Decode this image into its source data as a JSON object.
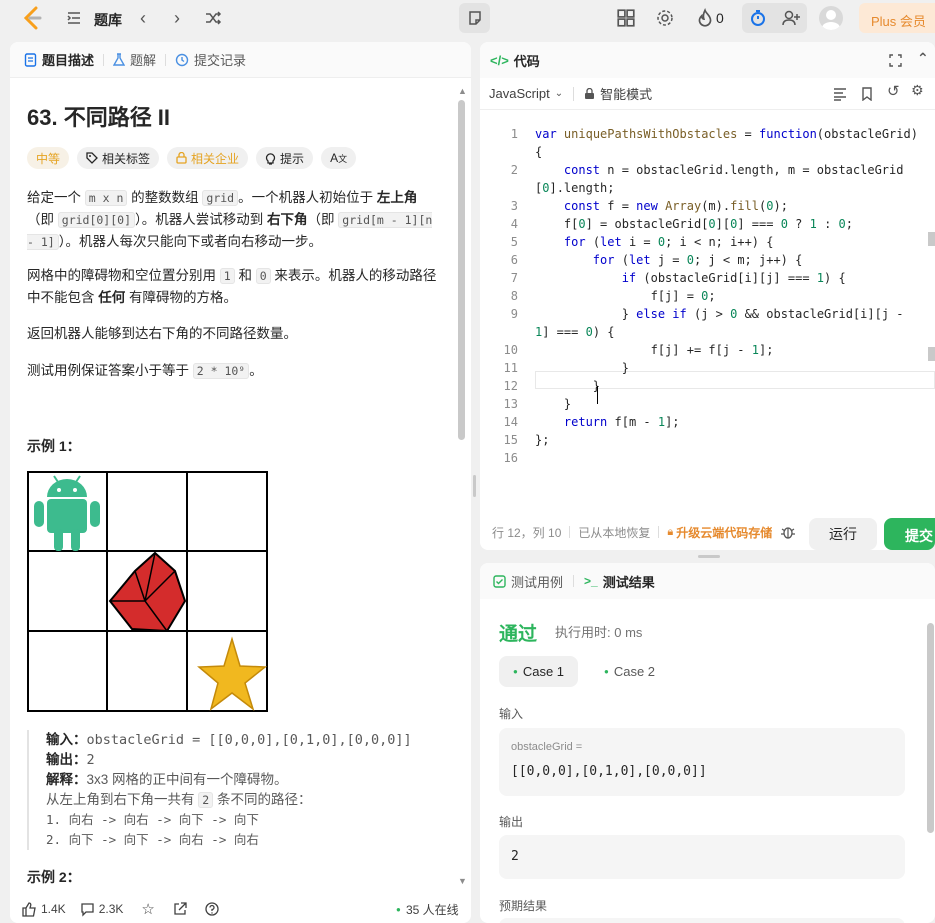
{
  "topbar": {
    "title": "题库",
    "fire_count": "0",
    "plus_label": "Plus 会员"
  },
  "left": {
    "tabs": [
      {
        "label": "题目描述"
      },
      {
        "label": "题解"
      },
      {
        "label": "提交记录"
      }
    ],
    "problem_title": "63. 不同路径 II",
    "badges": {
      "difficulty": "中等",
      "tags": "相关标签",
      "companies": "相关企业",
      "hint": "提示"
    },
    "desc": {
      "p1_a": "给定一个 ",
      "p1_code1": "m x n",
      "p1_b": " 的整数数组 ",
      "p1_code2": "grid",
      "p1_c": "。一个机器人初始位于 ",
      "p1_bold1": "左上角",
      "p1_d": "（即 ",
      "p1_code3": "grid[0][0]",
      "p1_e": "）。机器人尝试移动到 ",
      "p1_bold2": "右下角",
      "p1_f": "（即 ",
      "p1_code4": "grid[m - 1][n - 1]",
      "p1_g": "）。机器人每次只能向下或者向右移动一步。",
      "p2_a": "网格中的障碍物和空位置分别用 ",
      "p2_code1": "1",
      "p2_b": " 和 ",
      "p2_code2": "0",
      "p2_c": " 来表示。机器人的移动路径中不能包含 ",
      "p2_bold": "任何",
      "p2_d": " 有障碍物的方格。",
      "p3": "返回机器人能够到达右下角的不同路径数量。",
      "p4_a": "测试用例保证答案小于等于 ",
      "p4_code": "2 * 10⁹",
      "p4_b": "。"
    },
    "example1_title": "示例 1：",
    "example1": {
      "input_label": "输入：",
      "input_value": "obstacleGrid = [[0,0,0],[0,1,0],[0,0,0]]",
      "output_label": "输出：",
      "output_value": "2",
      "explain_label": "解释：",
      "explain_value": "3x3 网格的正中间有一个障碍物。",
      "line2_a": "从左上角到右下角一共有 ",
      "line2_code": "2",
      "line2_b": " 条不同的路径：",
      "line3": "1. 向右 -> 向右 -> 向下 -> 向下",
      "line4": "2. 向下 -> 向下 -> 向右 -> 向右"
    },
    "example2_title": "示例 2：",
    "footer": {
      "likes": "1.4K",
      "comments": "2.3K",
      "online": "35 人在线"
    }
  },
  "code": {
    "header": "代码",
    "language": "JavaScript",
    "mode": "智能模式",
    "lines": [
      {
        "n": "1",
        "text": "var uniquePathsWithObstacles = function(obstacleGrid)"
      },
      {
        "n": "",
        "text": "{"
      },
      {
        "n": "2",
        "text": "    const n = obstacleGrid.length, m = obstacleGrid"
      },
      {
        "n": "",
        "text": "[0].length;"
      },
      {
        "n": "3",
        "text": "    const f = new Array(m).fill(0);"
      },
      {
        "n": "4",
        "text": "    f[0] = obstacleGrid[0][0] === 0 ? 1 : 0;"
      },
      {
        "n": "5",
        "text": "    for (let i = 0; i < n; i++) {"
      },
      {
        "n": "6",
        "text": "        for (let j = 0; j < m; j++) {"
      },
      {
        "n": "7",
        "text": "            if (obstacleGrid[i][j] === 1) {"
      },
      {
        "n": "8",
        "text": "                f[j] = 0;"
      },
      {
        "n": "9",
        "text": "            } else if (j > 0 && obstacleGrid[i][j -"
      },
      {
        "n": "",
        "text": "1] === 0) {"
      },
      {
        "n": "10",
        "text": "                f[j] += f[j - 1];"
      },
      {
        "n": "11",
        "text": "            }"
      },
      {
        "n": "12",
        "text": "        }"
      },
      {
        "n": "13",
        "text": "    }"
      },
      {
        "n": "14",
        "text": "    return f[m - 1];"
      },
      {
        "n": "15",
        "text": "};"
      },
      {
        "n": "16",
        "text": ""
      }
    ],
    "status_pos": "行 12，列 10",
    "status_restore": "已从本地恢复",
    "status_upgrade": "升级云端代码存储",
    "run_label": "运行",
    "submit_label": "提交"
  },
  "result": {
    "tab_cases": "测试用例",
    "tab_result": "测试结果",
    "status": "通过",
    "runtime": "执行用时: 0 ms",
    "cases": [
      "Case 1",
      "Case 2"
    ],
    "input_label": "输入",
    "param_name": "obstacleGrid =",
    "param_value": "[[0,0,0],[0,1,0],[0,0,0]]",
    "output_label": "输出",
    "output_value": "2",
    "expected_label": "预期结果"
  }
}
